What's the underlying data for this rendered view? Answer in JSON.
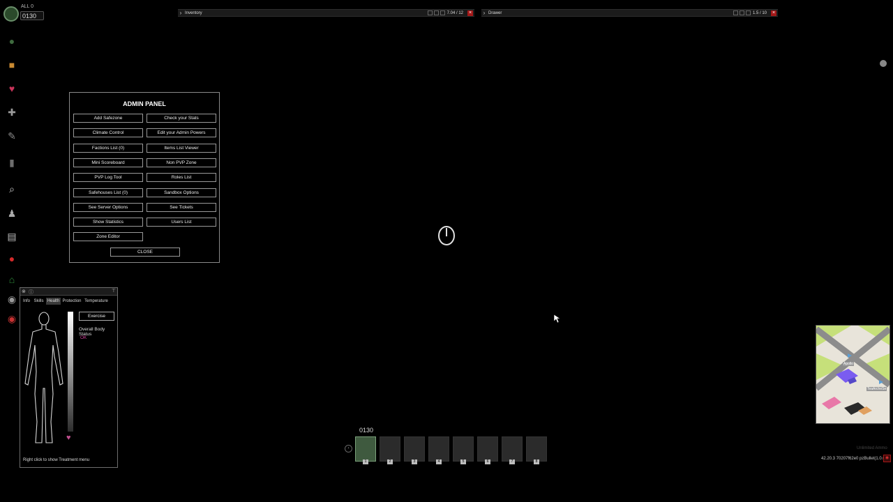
{
  "status": {
    "top_label": "ALL 0",
    "clock": "0130"
  },
  "sidebar": {
    "icons": [
      {
        "name": "status-icon",
        "glyph": "●",
        "color": "#3f6b3f"
      },
      {
        "name": "inventory-box-icon",
        "glyph": "■",
        "color": "#c98a32"
      },
      {
        "name": "health-heart-icon",
        "glyph": "♥",
        "color": "#c8345a"
      },
      {
        "name": "crafting-icon",
        "glyph": "✚",
        "color": "#9a9a9a"
      },
      {
        "name": "build-icon",
        "glyph": "✎",
        "color": "#8a8a8a"
      },
      {
        "name": "container-icon",
        "glyph": "▮",
        "color": "#6d6d6d"
      },
      {
        "name": "search-icon",
        "glyph": "⌕",
        "color": "#cfcfcf"
      },
      {
        "name": "admin-figures-icon",
        "glyph": "♟",
        "color": "#aaaaaa"
      },
      {
        "name": "map-scroll-icon",
        "glyph": "▤",
        "color": "#bdbdbd"
      },
      {
        "name": "map-pin-icon",
        "glyph": "●",
        "color": "#d42a2a"
      },
      {
        "name": "safehouse-icon",
        "glyph": "⌂",
        "color": "#2e8b3a"
      },
      {
        "name": "user-badge-icon",
        "glyph": "◉",
        "color": "#9a9a9a"
      },
      {
        "name": "ticket-badge-icon",
        "glyph": "◉",
        "color": "#c83232"
      }
    ]
  },
  "inventory": {
    "title": "Inventory",
    "weight": "7.04 / 12"
  },
  "drawer": {
    "title": "Drawer",
    "weight": "1.5 / 10"
  },
  "admin_panel": {
    "title": "ADMIN PANEL",
    "buttons": [
      "Add Safezone",
      "Check your Stats",
      "Climate Control",
      "Edit your Admin Powers",
      "Factions List (0)",
      "Items List Viewer",
      "Mini Scoreboard",
      "Non PVP Zone",
      "PVP Log Tool",
      "Roles List",
      "Safehouses List (0)",
      "Sandbox Options",
      "See Server Options",
      "See Tickets",
      "Show Statistics",
      "Users List",
      "Zone Editor"
    ],
    "close_label": "CLOSE"
  },
  "character_panel": {
    "tabs": [
      "Info",
      "Skills",
      "Health",
      "Protection",
      "Temperature"
    ],
    "active_tab": "Health",
    "exercise_label": "Exercise",
    "body_status_label": "Overall Body Status",
    "body_status_value": "OK",
    "hint": "Right click to show Treatment menu",
    "accent_color": "#d2409a"
  },
  "hotbar": {
    "clock": "0130",
    "slots": [
      "1",
      "2",
      "3",
      "4",
      "5",
      "6",
      "7",
      "8"
    ],
    "active_slot": "1"
  },
  "minimap": {
    "labels": [
      "Apollo",
      "TeaArcheSe"
    ]
  },
  "footer": {
    "unlimited_ammo": "Unlimited Ammo",
    "version": "42.20.3 70207f62e0 pzBullet(1.0.0.2)"
  }
}
